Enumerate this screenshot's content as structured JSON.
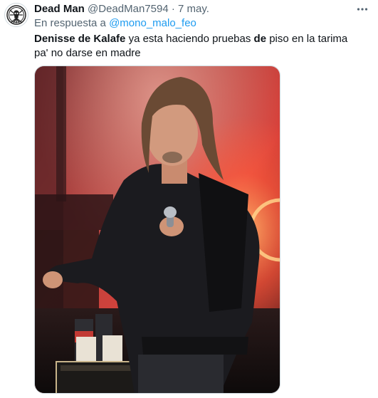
{
  "tweet": {
    "author": {
      "display_name": "Dead Man",
      "handle": "@DeadMan7594",
      "avatar_icon": "hydra-skull-icon"
    },
    "separator": "·",
    "date": "7 may.",
    "reply": {
      "prefix": "En respuesta a",
      "mention": "@mono_malo_feo"
    },
    "text_parts": [
      {
        "text": "Denisse de Kalafe",
        "bold": true
      },
      {
        "text": " ya esta haciendo pruebas ",
        "bold": false
      },
      {
        "text": "de",
        "bold": true
      },
      {
        "text": " piso en la tarima pa' no darse en madre",
        "bold": false
      }
    ],
    "media": {
      "kind": "photo",
      "alt": "",
      "background_accent": "#d9413a",
      "jacket_color": "#1b1b1f"
    },
    "more_icon": "more-horizontal-icon"
  },
  "colors": {
    "text_primary": "#0f1419",
    "text_secondary": "#536471",
    "link": "#1d9bf0",
    "border": "#cfd9de"
  }
}
